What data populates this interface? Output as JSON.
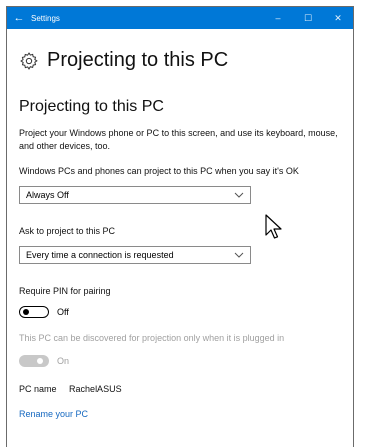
{
  "window": {
    "title": "Settings",
    "accent": "#0078d7",
    "controls": {
      "minimize": "–",
      "maximize": "☐",
      "close": "✕"
    },
    "back_icon": "←"
  },
  "page": {
    "title": "Projecting to this PC",
    "section_title": "Projecting to this PC",
    "description": "Project your Windows phone or PC to this screen, and use its keyboard, mouse, and other devices, too."
  },
  "projection": {
    "label": "Windows PCs and phones can project to this PC when you say it's OK",
    "value": "Always Off"
  },
  "ask": {
    "label": "Ask to project to this PC",
    "value": "Every time a connection is requested"
  },
  "pin": {
    "label": "Require PIN for pairing",
    "state": "Off"
  },
  "plugged": {
    "label": "This PC can be discovered for projection only when it is plugged in",
    "state": "On"
  },
  "pc": {
    "name_label": "PC name",
    "name_value": "RachelASUS",
    "rename_link": "Rename your PC"
  },
  "colors": {
    "link": "#1568c0",
    "muted": "#a0a0a0"
  }
}
